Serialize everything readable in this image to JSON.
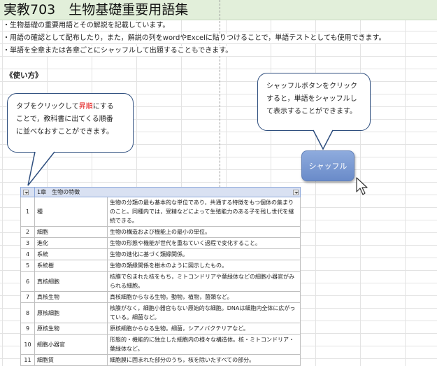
{
  "title": "実教703　生物基礎重要用語集",
  "description": [
    "・生物基礎の重要用語とその解説を記載しています。",
    "・用語の確認として配布したり，また，解説の列をwordやExcelに貼りつけることで，単語テストとしても使用できます。",
    "・単語を全章または各章ごとにシャッフルして出題することもできます。"
  ],
  "howto": "《使い方》",
  "bubble_left": {
    "line1_pre": "タブをクリックして",
    "line1_red": "昇順",
    "line1_post": "にする",
    "line2": "ことで，教科書に出てくる順番",
    "line3": "に並べなおすことができます。"
  },
  "bubble_right": {
    "line1": "シャッフルボタンをクリック",
    "line2": "すると，単語をシャッフルし",
    "line3": "て表示することができます。"
  },
  "shuffle_button": "シャッフル",
  "table": {
    "header": "1章　生物の特徴",
    "rows": [
      {
        "num": "1",
        "term": "種",
        "desc": "生物の分類の最も基本的な単位であり，共通する特徴をもつ個体の集まりのこと。同種内では，受精などによって生殖能力のある子を残し世代を継続できる。"
      },
      {
        "num": "2",
        "term": "細胞",
        "desc": "生物の構造および機能上の最小の単位。"
      },
      {
        "num": "3",
        "term": "進化",
        "desc": "生物の形態や機能が世代を重ねていく過程で変化すること。"
      },
      {
        "num": "4",
        "term": "系統",
        "desc": "生物の進化に基づく類縁関係。"
      },
      {
        "num": "5",
        "term": "系統樹",
        "desc": "生物の類縁関係を樹木のように図示したもの。"
      },
      {
        "num": "6",
        "term": "真核細胞",
        "desc": "核膜で包まれた核をもち，ミトコンドリアや葉緑体などの細胞小器官がみられる細胞。"
      },
      {
        "num": "7",
        "term": "真核生物",
        "desc": "真核細胞からなる生物。動物，植物，菌類など。"
      },
      {
        "num": "8",
        "term": "原核細胞",
        "desc": "核膜がなく，細胞小器官もない原始的な細胞。DNAは細胞内全体に広がっている。細菌など。"
      },
      {
        "num": "9",
        "term": "原核生物",
        "desc": "原核細胞からなる生物。細菌，シアノバクテリアなど。"
      },
      {
        "num": "10",
        "term": "細胞小器官",
        "desc": "形態的・機能的に独立した細胞内の様々な構造体。核・ミトコンドリア・葉緑体など。"
      },
      {
        "num": "11",
        "term": "細胞質",
        "desc": "細胞膜に囲まれた部分のうち，核を除いたすべての部分。"
      }
    ]
  },
  "colors": {
    "title_bg": "#e2efda",
    "header_bg": "#d9e1f2",
    "button": "#7796d0",
    "bubble_border": "#2e4e7e",
    "accent_red": "#e01010"
  }
}
